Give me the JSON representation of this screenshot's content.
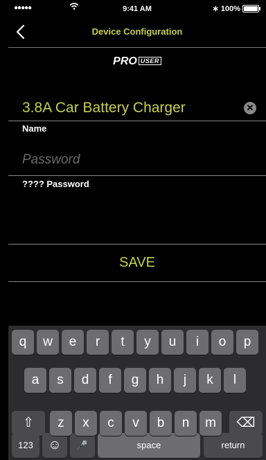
{
  "status": {
    "signal": "●●●●●",
    "time": "9:41 AM",
    "bluetooth": "∗",
    "battery": "100%"
  },
  "nav": {
    "back_icon": "chevron-left-icon",
    "title": "Device Configuration"
  },
  "logo": {
    "text": "PRO",
    "box": "USER"
  },
  "device": {
    "name": "3.8A Car Battery Charger",
    "clear_glyph": "✕"
  },
  "fields": {
    "name_label": "Name",
    "password_placeholder": "Password",
    "password_confirm_label": "???? Password"
  },
  "save_label": "SAVE",
  "keyboard": {
    "row1": [
      "q",
      "w",
      "e",
      "r",
      "t",
      "y",
      "u",
      "i",
      "o",
      "p"
    ],
    "row2": [
      "a",
      "s",
      "d",
      "f",
      "g",
      "h",
      "j",
      "k",
      "l"
    ],
    "row3": [
      "z",
      "x",
      "c",
      "v",
      "b",
      "n",
      "m"
    ],
    "shift": "⇧",
    "delete": "⌫",
    "numbers": "123",
    "emoji": "☺",
    "mic": "🎤",
    "space": "space",
    "return": "return"
  }
}
